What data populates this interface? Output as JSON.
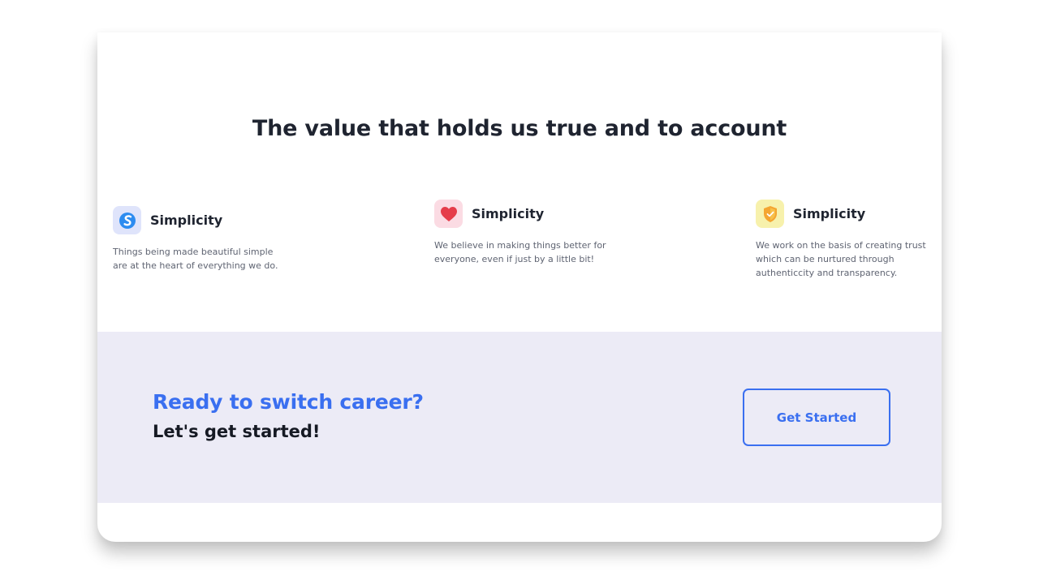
{
  "values": {
    "title": "The value that holds us true and to account",
    "items": [
      {
        "icon": "simplicity-logo-icon",
        "tile_color": "#dfe4fb",
        "title": "Simplicity",
        "description": "Things being made beautiful simple are at the heart of everything we do."
      },
      {
        "icon": "heart-icon",
        "tile_color": "#fbdbe3",
        "title": "Simplicity",
        "description": "We believe in making things better for everyone, even if just by a little bit!"
      },
      {
        "icon": "shield-check-icon",
        "tile_color": "#f7f1ac",
        "title": "Simplicity",
        "description": "We work on the basis of creating trust which can be nurtured through authenticcity and transparency."
      }
    ]
  },
  "cta": {
    "heading": "Ready to switch career?",
    "subheading": "Let's get started!",
    "button_label": "Get Started",
    "background": "#ecebf6",
    "accent": "#3a6ff0"
  }
}
